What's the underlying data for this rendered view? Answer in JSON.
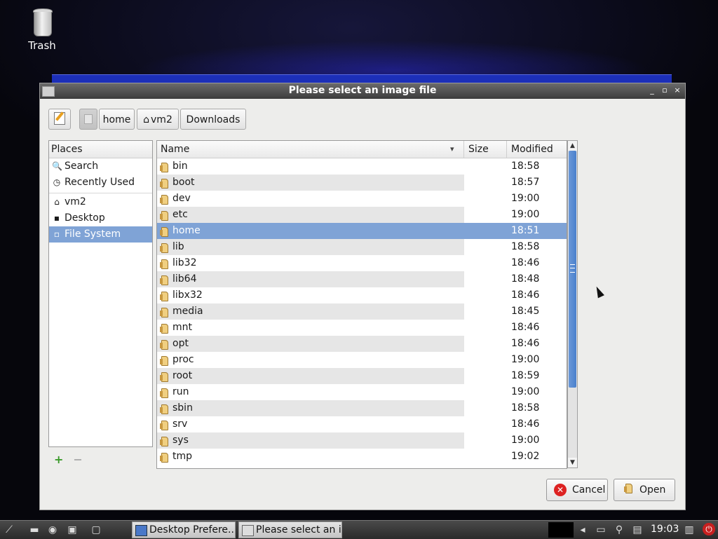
{
  "desktop": {
    "trash_label": "Trash"
  },
  "dialog": {
    "title": "Please select an image file",
    "controls": {
      "minimize": "_",
      "maximize": "▫",
      "close": "×"
    },
    "path_buttons": [
      "home",
      "vm2",
      "Downloads"
    ],
    "places": {
      "header": "Places",
      "items": [
        {
          "label": "Search",
          "icon": "magnifier-icon"
        },
        {
          "label": "Recently Used",
          "icon": "clock-icon"
        },
        {
          "label": "vm2",
          "icon": "home-icon"
        },
        {
          "label": "Desktop",
          "icon": "desktop-icon"
        },
        {
          "label": "File System",
          "icon": "drive-icon",
          "selected": true
        }
      ],
      "add": "+",
      "remove": "−"
    },
    "columns": {
      "name": "Name",
      "size": "Size",
      "modified": "Modified"
    },
    "files": [
      {
        "name": "bin",
        "modified": "18:58"
      },
      {
        "name": "boot",
        "modified": "18:57"
      },
      {
        "name": "dev",
        "modified": "19:00"
      },
      {
        "name": "etc",
        "modified": "19:00"
      },
      {
        "name": "home",
        "modified": "18:51",
        "selected": true
      },
      {
        "name": "lib",
        "modified": "18:58"
      },
      {
        "name": "lib32",
        "modified": "18:46"
      },
      {
        "name": "lib64",
        "modified": "18:48"
      },
      {
        "name": "libx32",
        "modified": "18:46"
      },
      {
        "name": "media",
        "modified": "18:45"
      },
      {
        "name": "mnt",
        "modified": "18:46"
      },
      {
        "name": "opt",
        "modified": "18:46"
      },
      {
        "name": "proc",
        "modified": "19:00"
      },
      {
        "name": "root",
        "modified": "18:59"
      },
      {
        "name": "run",
        "modified": "19:00"
      },
      {
        "name": "sbin",
        "modified": "18:58"
      },
      {
        "name": "srv",
        "modified": "18:46"
      },
      {
        "name": "sys",
        "modified": "19:00"
      },
      {
        "name": "tmp",
        "modified": "19:02"
      }
    ],
    "buttons": {
      "cancel": "Cancel",
      "open": "Open"
    }
  },
  "taskbar": {
    "tasks": [
      {
        "label": "Desktop Prefere...",
        "active": false
      },
      {
        "label": "Please select an i...",
        "active": true
      }
    ],
    "clock": "19:03"
  }
}
